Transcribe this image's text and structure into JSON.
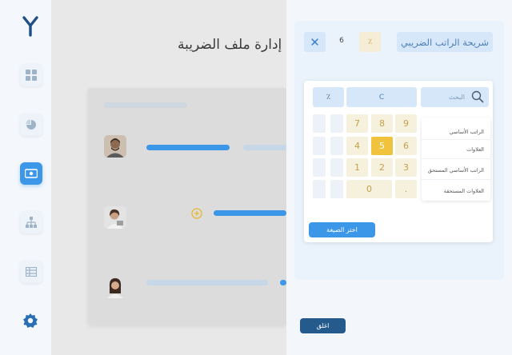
{
  "sidebar": {
    "logo_icon": "brand-logo-icon",
    "items": [
      {
        "icon": "dashboard-grid-icon",
        "active": false
      },
      {
        "icon": "pie-chart-icon",
        "active": false
      },
      {
        "icon": "money-bill-icon",
        "active": true
      },
      {
        "icon": "org-chart-icon",
        "active": false
      },
      {
        "icon": "table-icon",
        "active": false
      }
    ],
    "settings_icon": "gear-icon",
    "accent": "#3d97e8"
  },
  "main": {
    "title": "إدارة ملف الضريبة"
  },
  "panel": {
    "title": "شريحة الراتب الضريبي",
    "value": "6",
    "percent_symbol": "٪",
    "close_symbol": "✕",
    "formula": {
      "percent_button": "٪",
      "clear_button": "C",
      "search_placeholder": "البحث",
      "keys": [
        "7",
        "8",
        "9",
        "4",
        "5",
        "6",
        "1",
        "2",
        "3",
        "0",
        "."
      ],
      "selected_key": "5",
      "variables": [
        "الراتب الأساسي",
        "العلاوات",
        "الراتب الأساسي المستحق",
        "العلاوات المستحقة"
      ],
      "choose_button": "اختر الصيغة"
    },
    "close_button": "اغلق"
  },
  "colors": {
    "primary": "#3d97e8",
    "dark_button": "#245b8c",
    "key_highlight": "#f1c33c",
    "key_bg": "#f5f1dd"
  }
}
